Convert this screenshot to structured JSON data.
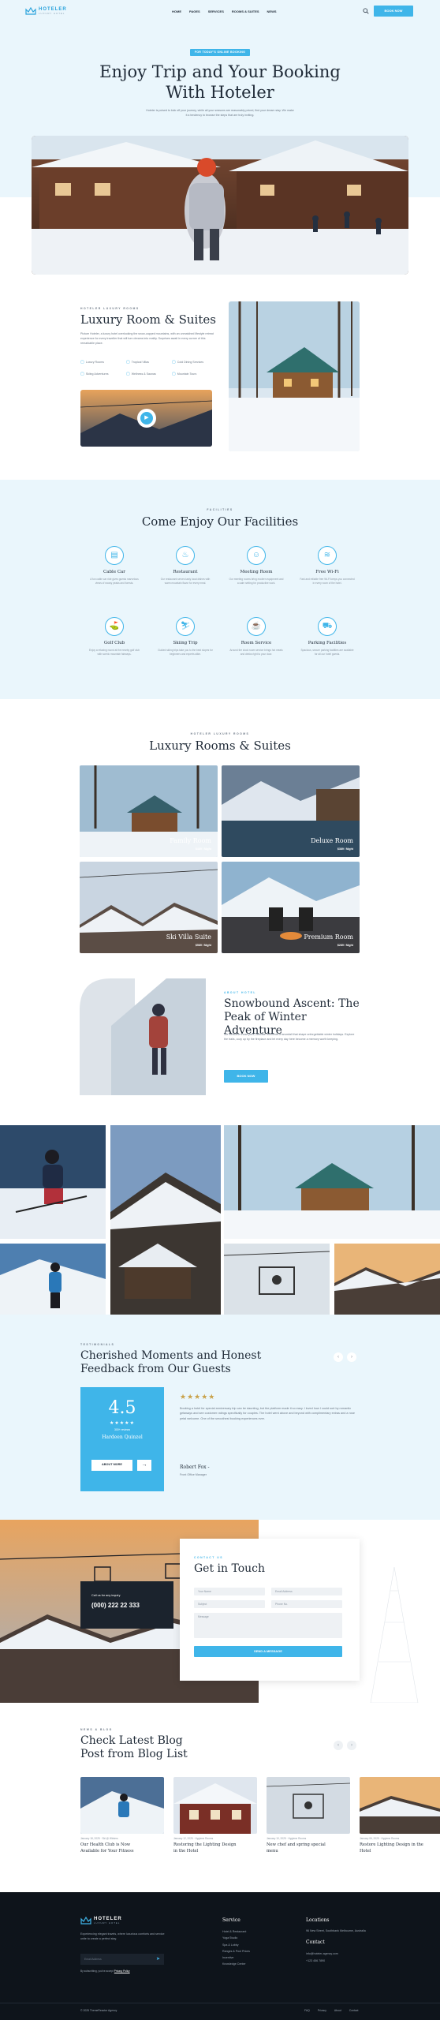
{
  "brand": {
    "name": "HOTELER",
    "tagline": "LUXURY HOTEL"
  },
  "nav": {
    "links": [
      "HOME",
      "PAGES",
      "SERVICES",
      "ROOMS & SUITES",
      "NEWS"
    ],
    "cta": "BOOK NOW"
  },
  "hero": {
    "pill": "FOR TODAY'S ONLINE BOOKING",
    "title_line1": "Enjoy Trip and Your Booking",
    "title_line2": "With Hoteler",
    "lead_line1": "Hoteler is poised to kick off your journey, while all your seasons are reasonably priced, find your dream stay. We make",
    "lead_line2": "it a tendency to browse the steps that are truly inviting."
  },
  "about": {
    "eyebrow": "HOTELER LUXURY ROOMS",
    "title": "Luxury Room & Suites",
    "text": "Picture Hoteler, a luxury hotel overlooking the snow-capped mountains, with an unmatched lifestyle retreat experience for every traveller that will turn dreams into reality. Surprises await in every corner of this remarkable place.",
    "features": [
      "Luxury Rooms",
      "Tropical Villas",
      "Cold Dining Services",
      "Skiing Adventures",
      "Wellness & Saunas",
      "Mountain Tours"
    ]
  },
  "facilities": {
    "eyebrow": "FACILITIES",
    "title": "Come Enjoy Our Facilities",
    "items": [
      {
        "name": "Cable Car",
        "desc": "A fun cable car ride gives guests marvelous views of snowy peaks and forests."
      },
      {
        "name": "Restaurant",
        "desc": "Our restaurant serves tasty local dishes with warm mountain flavor for every meal."
      },
      {
        "name": "Meeting Room",
        "desc": "Our meeting rooms bring modern equipment and a calm setting for productive work."
      },
      {
        "name": "Free Wi-Fi",
        "desc": "Fast and reliable free Wi-Fi keeps you connected in every room of the hotel."
      },
      {
        "name": "Golf Club",
        "desc": "Enjoy a relaxing round at the nearby golf club with scenic mountain fairways."
      },
      {
        "name": "Skiing Trip",
        "desc": "Guided skiing trips take you to the best slopes for beginners and experts alike."
      },
      {
        "name": "Room Service",
        "desc": "Around the clock room service brings hot meals and drinks right to your door."
      },
      {
        "name": "Parking Facilities",
        "desc": "Spacious, secure parking facilities are available for all our hotel guests."
      }
    ]
  },
  "rooms": {
    "eyebrow": "HOTELER LUXURY ROOMS",
    "title": "Luxury Rooms & Suites",
    "items": [
      {
        "name": "Family Room",
        "price": "$489 / Night"
      },
      {
        "name": "Deluxe Room",
        "price": "$389 / Night"
      },
      {
        "name": "Ski Villa Suite",
        "price": "$589 / Night"
      },
      {
        "name": "Premium Room",
        "price": "$289 / Night"
      }
    ]
  },
  "ascent": {
    "eyebrow": "ABOUT HOTEL",
    "title_line1": "Snowbound Ascent: The",
    "title_line2": "Peak of Winter Adventure",
    "text": "We welcome those pure, delicate moments of snowfall that shape unforgettable winter holidays. Explore the trails, cozy up by the fireplace and let every day here become a memory worth keeping.",
    "button": "BOOK NOW"
  },
  "testimonials": {
    "eyebrow": "TESTIMONIALS",
    "title_line1": "Cherished Moments and Honest",
    "title_line2": "Feedback from Our Guests",
    "rating": "4.5",
    "stars": "★★★★★",
    "reviews_label": "300+ reviews",
    "reviewer": "Hardeen Quinzel",
    "about_button": "ABOUT MORE",
    "quote_stars": "★★★★★",
    "quote": "Booking a hotel for special anniversary trip can be daunting, but the platform made it so easy. I loved how I could sort by romantic getaways and see customer ratings specifically for couples. The hotel went above and beyond with complimentary extras and a rose petal welcome. One of the smoothest booking experiences ever.",
    "author": "Robert Fox -",
    "author_role": "Front Office Manager"
  },
  "contact": {
    "eyebrow": "CONTACT US",
    "title": "Get in Touch",
    "call_label": "Call us for any inquiry",
    "phone": "(000) 222 22 333",
    "fields": [
      "Your Name",
      "Email Address",
      "Subject",
      "Phone No."
    ],
    "message_placeholder": "Message",
    "submit": "SEND A MESSAGE"
  },
  "blog": {
    "eyebrow": "NEWS & BLOG",
    "title_line1": "Check Latest Blog",
    "title_line2": "Post from Blog List",
    "posts": [
      {
        "date": "January 18, 2025",
        "tag": "Ski @ Winters",
        "title_line1": "Our Health Club is Now",
        "title_line2": "Available for Your Fitness"
      },
      {
        "date": "January 12, 2025",
        "tag": "Hygiene Rooms",
        "title_line1": "Restoring the Lighting Design",
        "title_line2": "in the Hotel"
      },
      {
        "date": "January 10, 2025",
        "tag": "Hygiene Rooms",
        "title_line1": "New chef and spring special",
        "title_line2": "menu"
      },
      {
        "date": "January 06, 2025",
        "tag": "Hygiene Rooms",
        "title_line1": "Restore Lighting Design in the",
        "title_line2": "Hotel"
      }
    ]
  },
  "footer": {
    "about": "Experiencing elegant travels, where luxurious comforts and service unite to create a perfect stay.",
    "newsletter_placeholder": "Email Address",
    "agree_text": "By subscribing, you've accept",
    "privacy": "Privacy Policy",
    "service_title": "Service",
    "service_links": [
      "Hotel & Restaurant",
      "Yoga Studio",
      "Spa & Lobby",
      "Ranges & Pool Prices",
      "Incentive",
      "Knowledge Center"
    ],
    "locations_title": "Locations",
    "location_address": "96 New Street, Southbank Melbourne, Australia",
    "contact_title": "Contact",
    "email": "info@hoteler-agency.com",
    "phone": "+123 456 7890",
    "copyright": "© 2025 ThemeReactor Agency",
    "bottom_links": [
      "FAQ",
      "Privacy",
      "About",
      "Contact"
    ]
  },
  "colors": {
    "accent": "#3fb5e9",
    "dark": "#0e141b",
    "light": "#eaf6fc",
    "star": "#c9a24b"
  }
}
